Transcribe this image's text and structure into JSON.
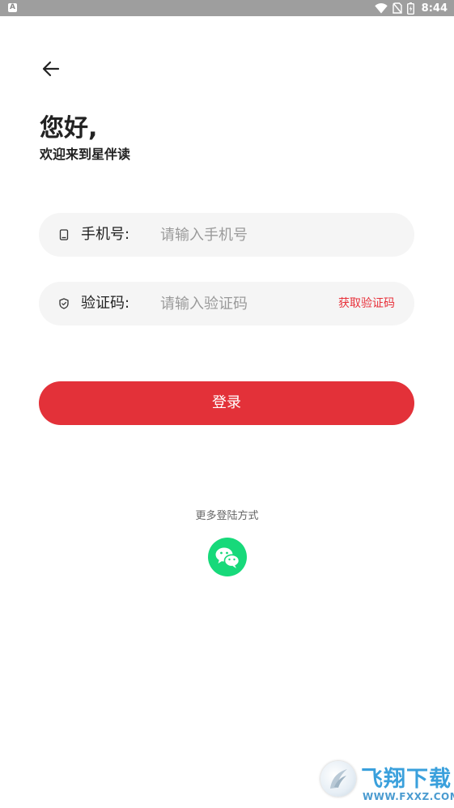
{
  "status_bar": {
    "app_icon": "A",
    "time": "8:44",
    "icons": [
      "wifi-icon",
      "no-sim-icon",
      "battery-icon"
    ]
  },
  "header": {
    "back_icon": "back-arrow-icon"
  },
  "greeting": {
    "title": "您好,",
    "subtitle": "欢迎来到星伴读"
  },
  "form": {
    "phone": {
      "icon": "phone-icon",
      "label": "手机号:",
      "value": "",
      "placeholder": "请输入手机号"
    },
    "code": {
      "icon": "shield-icon",
      "label": "验证码:",
      "value": "",
      "placeholder": "请输入验证码",
      "get_code_label": "获取验证码"
    },
    "login_label": "登录"
  },
  "alt_login": {
    "label": "更多登陆方式",
    "wechat_icon": "wechat-icon"
  },
  "watermark": {
    "text": "飞翔下载",
    "url": "WWW.FXXZ.COM"
  },
  "colors": {
    "accent": "#e33139",
    "field_bg": "#f5f5f5",
    "wechat": "#17d97a",
    "status_bar": "#9e9e9e"
  }
}
